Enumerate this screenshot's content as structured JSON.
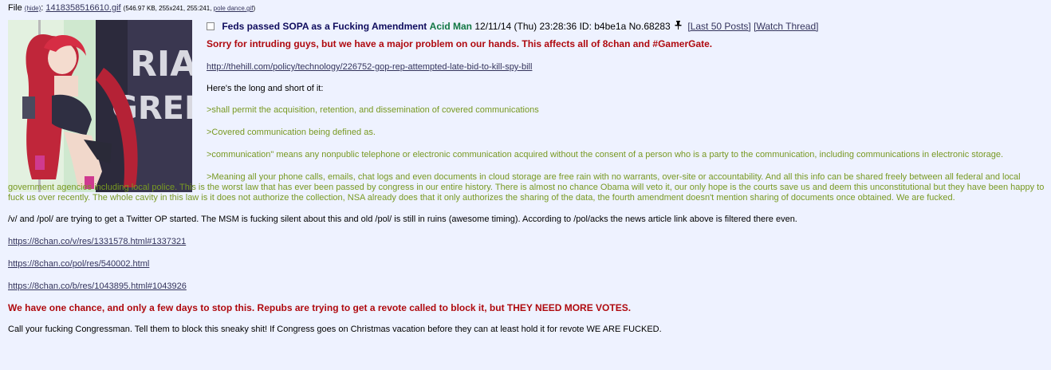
{
  "file": {
    "prefix": "File",
    "hide": "(hide)",
    "colon": ":",
    "filename": "1418358516610.gif",
    "meta_open": "(546.97 KB, 255x241, 255:241, ",
    "orig_name": "pole dance.gif",
    "meta_close": ")"
  },
  "post": {
    "subject": "Feds passed SOPA as a Fucking Amendment",
    "name": "Acid Man",
    "datetime": "12/11/14 (Thu) 23:28:36",
    "id": "ID: b4be1a",
    "no_prefix": "No.",
    "no": "68283",
    "last50": "[Last 50 Posts]",
    "watch": "[Watch Thread]",
    "pin_icon": "pin-icon"
  },
  "body": {
    "headline": "Sorry for intruding guys, but we have a major problem on our hands. This affects all of 8chan and #GamerGate.",
    "link1": "http://thehill.com/policy/technology/226752-gop-rep-attempted-late-bid-to-kill-spy-bill",
    "intro": "Here's the long and short of it:",
    "quote1": ">shall permit the acquisition, retention, and dissemination of covered communications",
    "quote2": ">Covered communication being defined as.",
    "quote3": ">communication\" means any nonpublic telephone or electronic communication acquired without the consent of a person who is a party to the communication, including communications in electronic storage.",
    "quote4": ">Meaning all your phone calls, emails, chat logs and even documents in cloud storage are free rain with no warrants, over-site or accountability. And all this info can be shared freely between all federal and local government agencies including local police. This is the worst law that has ever been passed by congress in our entire history. There is almost no chance Obama will veto it, our only hope is the courts save us and deem this unconstitutional but they have been happy to fuck us over recently. The whole cavity in this law is it does not authorize the collection, NSA already does that it only authorizes the sharing of the data, the fourth amendment doesn't mention sharing of documents once obtained. We are fucked.",
    "para_twitter": "/v/ and /pol/ are trying to get a Twitter OP started. The MSM is fucking silent about this and old /pol/ is still in ruins (awesome timing). According to /pol/acks the news article link above is filtered there even.",
    "link2": "https://8chan.co/v/res/1331578.html#1337321",
    "link3": "https://8chan.co/pol/res/540002.html",
    "link4": "https://8chan.co/b/res/1043895.html#1043926",
    "headline2": "We have one chance, and only a few days to stop this. Repubs are trying to get a revote called to block it, but THEY NEED MORE VOTES.",
    "closing": "Call your fucking Congressman. Tell them to block this sneaky shit! If Congress goes on Christmas vacation before they can at least hold it for revote WE ARE FUCKED."
  },
  "thumb_text": {
    "line1": "RIA",
    "line2": "GREN"
  },
  "colors": {
    "background": "#eef2ff",
    "subject": "#0f0c5d",
    "name": "#117743",
    "headline": "#af0a0f",
    "greentext": "#789922",
    "link": "#34345c"
  }
}
